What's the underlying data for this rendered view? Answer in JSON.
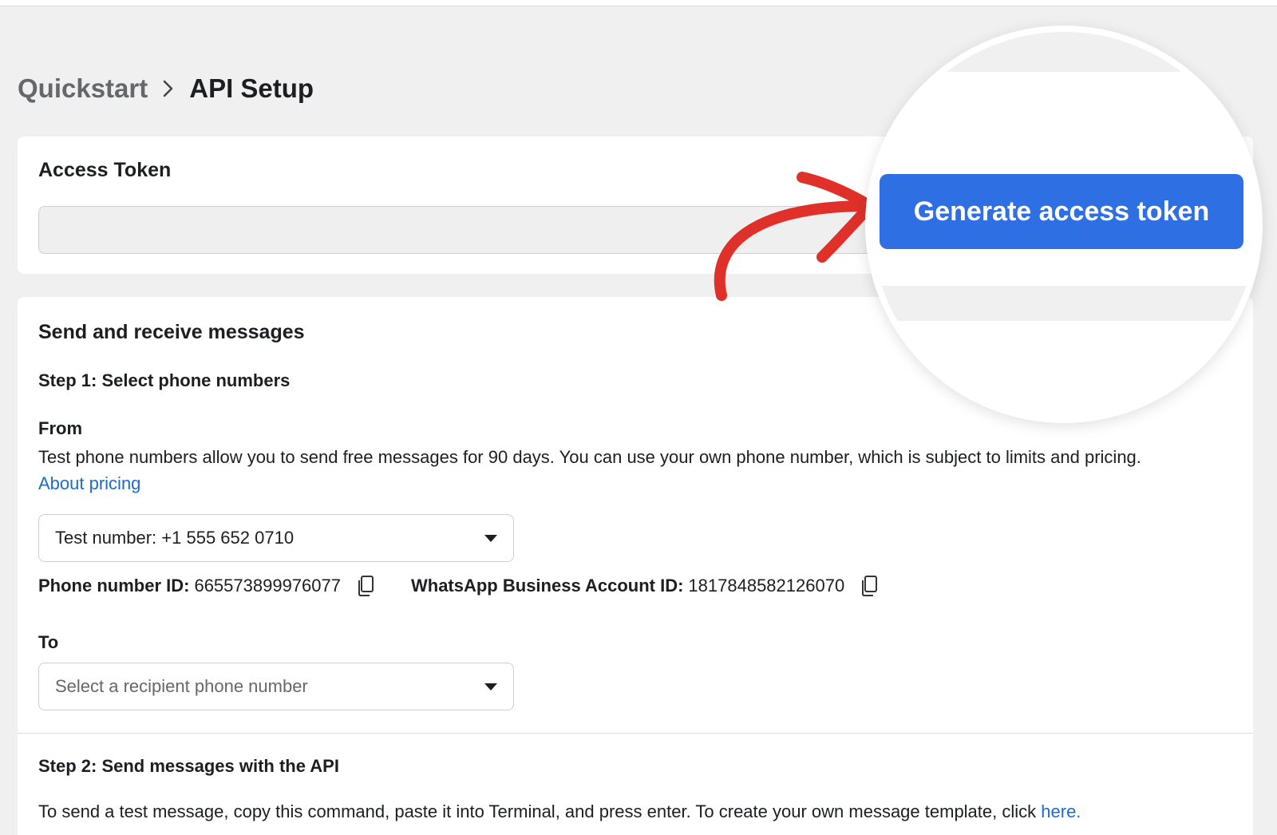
{
  "breadcrumb": {
    "parent": "Quickstart",
    "current": "API Setup"
  },
  "access_token": {
    "title": "Access Token",
    "value": ""
  },
  "generate_button": {
    "label": "Generate access token"
  },
  "send": {
    "title": "Send and receive messages",
    "step1": "Step 1: Select phone numbers",
    "from_label": "From",
    "from_desc": "Test phone numbers allow you to send free messages for 90 days. You can use your own phone number, which is subject to limits and pricing.",
    "pricing_link": "About pricing",
    "from_select": "Test number: +1 555 652 0710",
    "phone_id_label": "Phone number ID:",
    "phone_id_value": "665573899976077",
    "waba_label": "WhatsApp Business Account ID:",
    "waba_value": "1817848582126070",
    "to_label": "To",
    "to_placeholder": "Select a recipient phone number",
    "step2": "Step 2: Send messages with the API",
    "step2_desc": "To send a test message, copy this command, paste it into Terminal, and press enter. To create your own message template, click ",
    "here_link": "here."
  },
  "colors": {
    "accent": "#2f6fe4",
    "link": "#1b6ad6",
    "arrow": "#e0302a"
  },
  "icons": [
    "chevron-right-icon",
    "copy-icon",
    "caret-down-icon",
    "arrow-icon"
  ]
}
